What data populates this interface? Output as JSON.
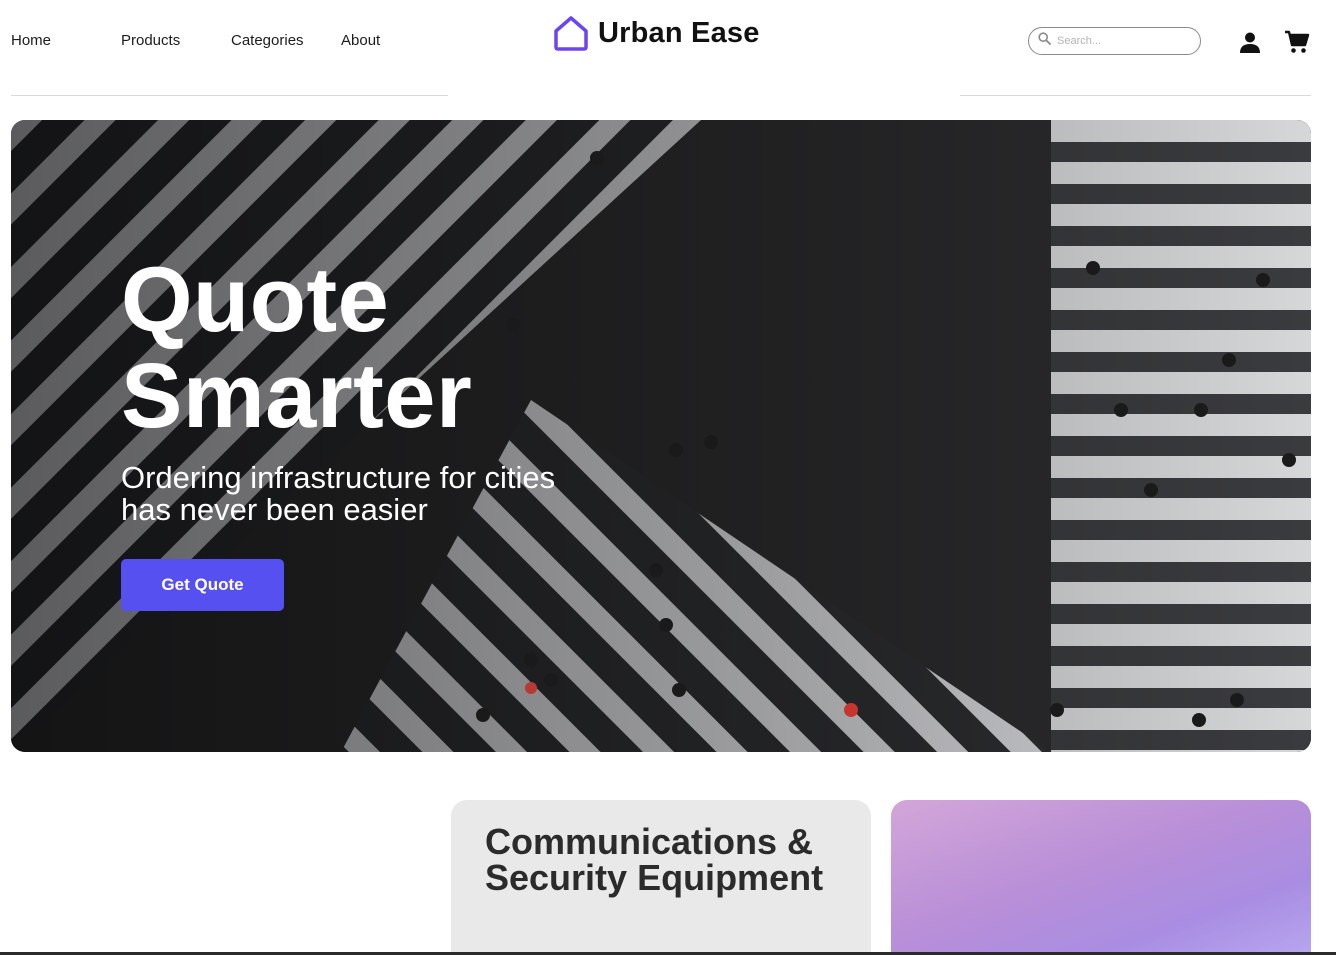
{
  "header": {
    "nav": [
      {
        "label": "Home"
      },
      {
        "label": "Products"
      },
      {
        "label": "Categories"
      },
      {
        "label": "About"
      }
    ],
    "logo": {
      "text": "Urban Ease",
      "icon": "house-outline-icon",
      "color": "#6b46f0"
    },
    "search": {
      "placeholder": "Search...",
      "value": ""
    },
    "icons": [
      "user-icon",
      "cart-icon"
    ]
  },
  "hero": {
    "title_line1": "Quote",
    "title_line2": "Smarter",
    "subtitle_line1": "Ordering infrastructure for cities",
    "subtitle_line2": "has never been easier",
    "cta_label": "Get Quote",
    "accent_color": "#5750f1",
    "image": "aerial-crosswalk-photo"
  },
  "categories": [
    {
      "title": "Communications & Security Equipment"
    },
    {
      "title": ""
    }
  ]
}
